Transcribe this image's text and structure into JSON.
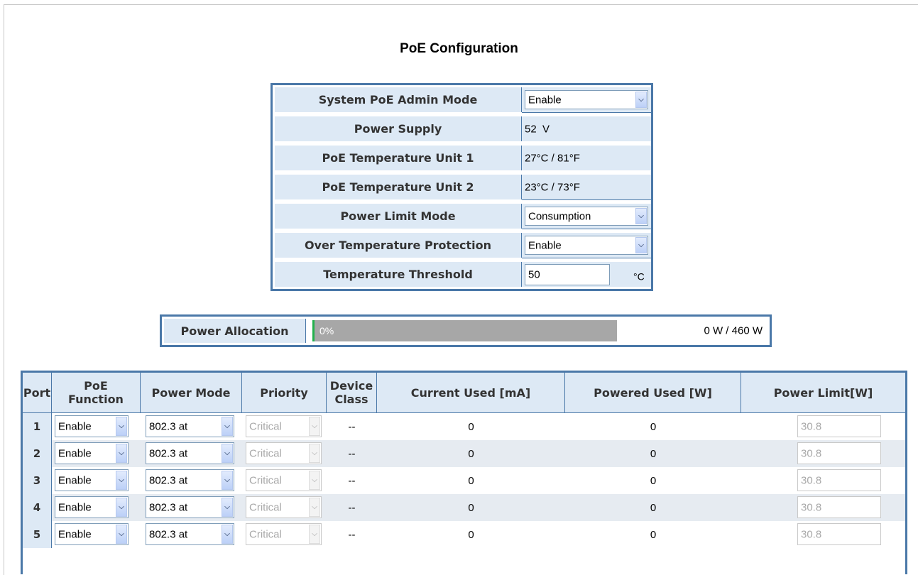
{
  "page": {
    "title": "PoE Configuration"
  },
  "config": {
    "admin_mode": {
      "label": "System PoE Admin Mode",
      "value": "Enable"
    },
    "power_supply": {
      "label": "Power Supply",
      "value": "52  V"
    },
    "temp_unit1": {
      "label": "PoE Temperature Unit 1",
      "value": "27°C / 81°F"
    },
    "temp_unit2": {
      "label": "PoE Temperature Unit 2",
      "value": "23°C / 73°F"
    },
    "power_limit_mode": {
      "label": "Power Limit Mode",
      "value": "Consumption"
    },
    "over_temp": {
      "label": "Over Temperature Protection",
      "value": "Enable"
    },
    "temp_threshold": {
      "label": "Temperature Threshold",
      "value": "50",
      "unit": "°C"
    }
  },
  "allocation": {
    "label": "Power Allocation",
    "percent_text": "0%",
    "percent": 0,
    "total": "0 W / 460 W"
  },
  "ports": {
    "headers": {
      "port": "Port",
      "poe_function_1": "PoE",
      "poe_function_2": "Function",
      "power_mode": "Power Mode",
      "priority": "Priority",
      "device_class_1": "Device",
      "device_class_2": "Class",
      "current": "Current Used [mA]",
      "powered": "Powered Used [W]",
      "limit": "Power Limit[W]"
    },
    "rows": [
      {
        "port": "1",
        "function": "Enable",
        "mode": "802.3 at",
        "priority": "Critical",
        "class": "--",
        "current": "0",
        "powered": "0",
        "limit": "30.8"
      },
      {
        "port": "2",
        "function": "Enable",
        "mode": "802.3 at",
        "priority": "Critical",
        "class": "--",
        "current": "0",
        "powered": "0",
        "limit": "30.8"
      },
      {
        "port": "3",
        "function": "Enable",
        "mode": "802.3 at",
        "priority": "Critical",
        "class": "--",
        "current": "0",
        "powered": "0",
        "limit": "30.8"
      },
      {
        "port": "4",
        "function": "Enable",
        "mode": "802.3 at",
        "priority": "Critical",
        "class": "--",
        "current": "0",
        "powered": "0",
        "limit": "30.8"
      },
      {
        "port": "5",
        "function": "Enable",
        "mode": "802.3 at",
        "priority": "Critical",
        "class": "--",
        "current": "0",
        "powered": "0",
        "limit": "30.8"
      }
    ]
  },
  "colors": {
    "border": "#4a78a8",
    "label_bg": "#dde9f5",
    "bar": "#a7a7a7",
    "bar_fill": "#22b14c"
  },
  "icons": {
    "dropdown": "chevron-down-icon"
  }
}
